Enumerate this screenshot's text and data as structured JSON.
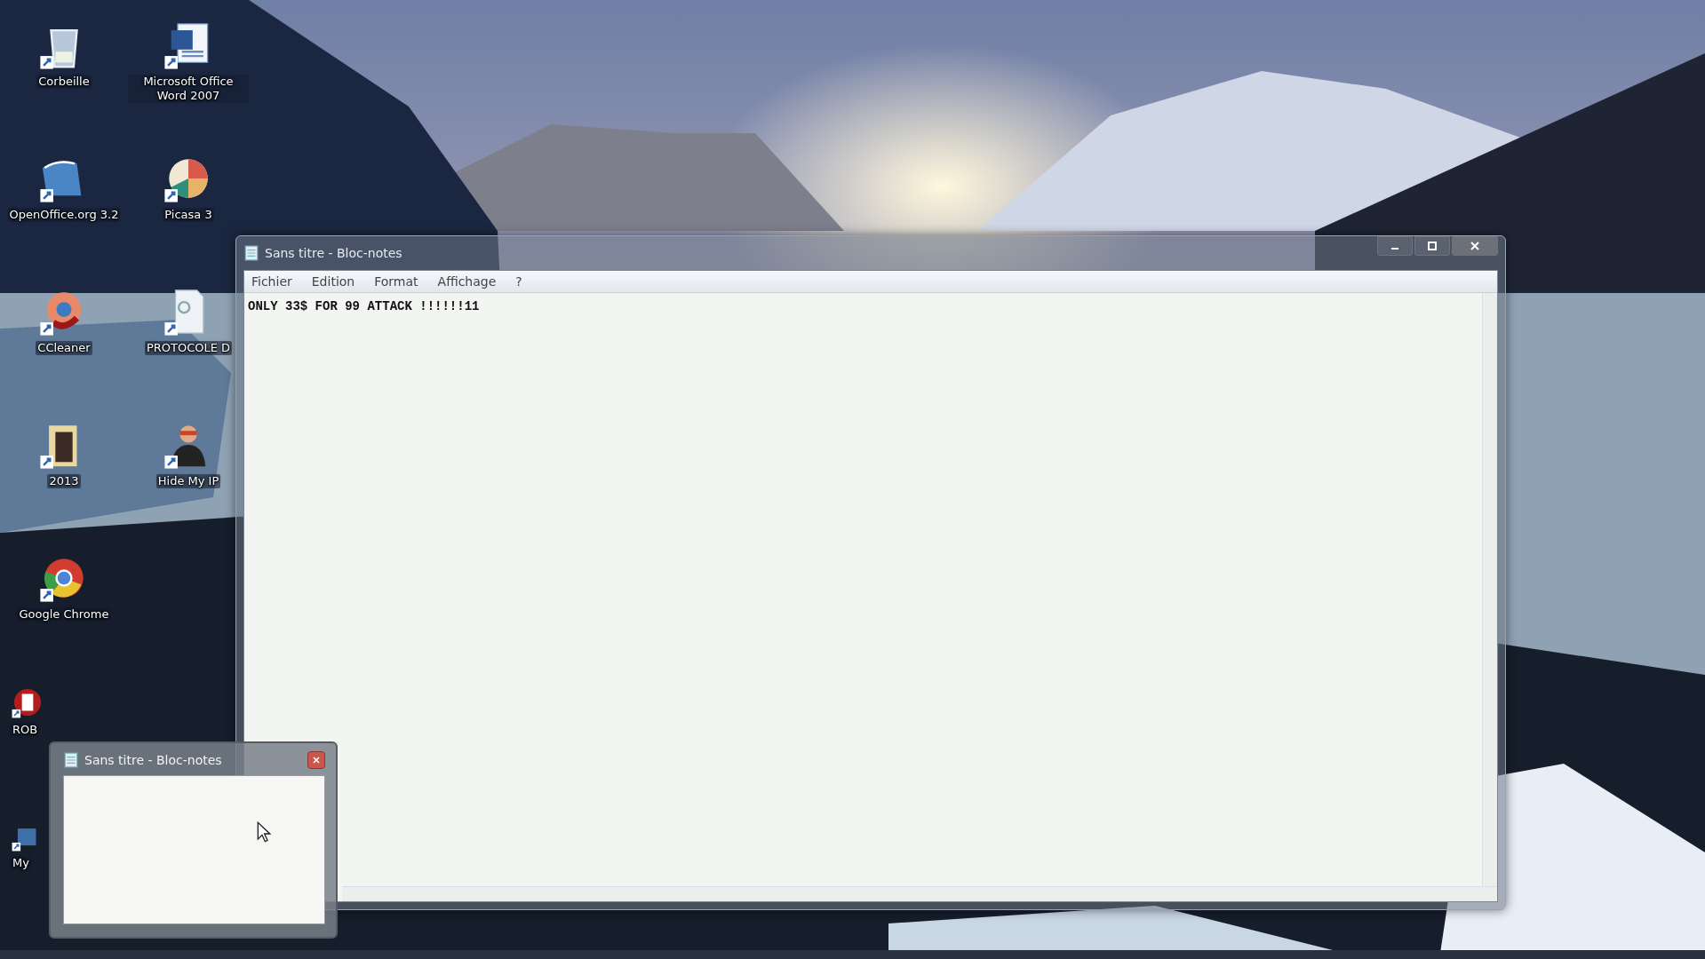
{
  "desktop_icons": [
    {
      "label": "Corbeille",
      "kind": "normal"
    },
    {
      "label": "OpenOffice.org 3.2",
      "kind": "normal"
    },
    {
      "label": "CCleaner",
      "kind": "normal"
    },
    {
      "label": "2013",
      "kind": "normal"
    },
    {
      "label": "Google Chrome",
      "kind": "normal"
    },
    {
      "label": "ROB",
      "kind": "covered"
    },
    {
      "label": "My",
      "kind": "covered"
    },
    {
      "label": "Microsoft Office Word 2007",
      "kind": "normal"
    },
    {
      "label": "Picasa 3",
      "kind": "normal"
    },
    {
      "label": "PROTOCOLE D",
      "kind": "normal"
    },
    {
      "label": "Hide My IP",
      "kind": "normal"
    }
  ],
  "notepad": {
    "title": "Sans titre - Bloc-notes",
    "menu": [
      "Fichier",
      "Edition",
      "Format",
      "Affichage",
      "?"
    ],
    "text": "ONLY 33$ FOR 99 ATTACK !!!!!!11"
  },
  "thumbnail": {
    "title": "Sans titre - Bloc-notes"
  }
}
